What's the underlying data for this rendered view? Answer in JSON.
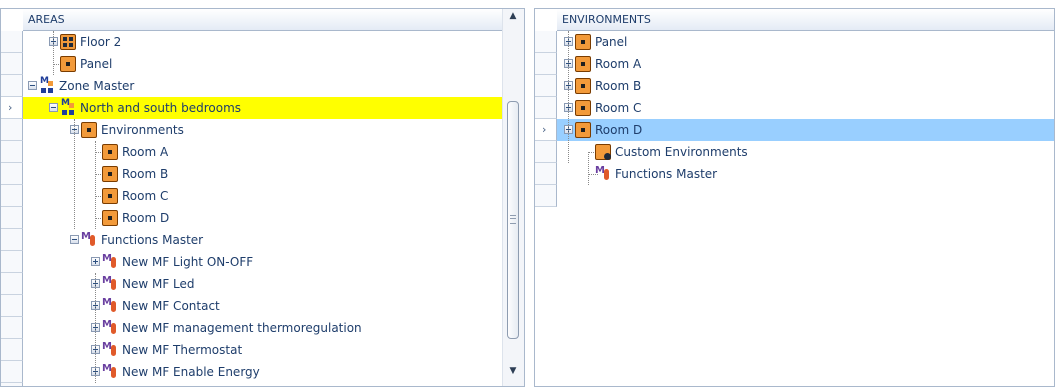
{
  "areas": {
    "header": "AREAS",
    "rows": [
      {
        "label": "Floor 2",
        "icon": "floor-icon",
        "expand": "plus"
      },
      {
        "label": "Panel",
        "icon": "environment-icon"
      },
      {
        "label": "Zone Master",
        "icon": "zone-master-icon",
        "expand": "minus"
      },
      {
        "label": "North and south bedrooms",
        "icon": "zone-master-icon",
        "expand": "minus",
        "highlighted": true
      },
      {
        "label": "Environments",
        "icon": "environment-icon",
        "expand": "minus"
      },
      {
        "label": "Room A",
        "icon": "environment-icon"
      },
      {
        "label": "Room B",
        "icon": "environment-icon"
      },
      {
        "label": "Room C",
        "icon": "environment-icon"
      },
      {
        "label": "Room D",
        "icon": "environment-icon"
      },
      {
        "label": "Functions Master",
        "icon": "functions-master-icon",
        "expand": "minus"
      },
      {
        "label": "New MF Light ON-OFF",
        "icon": "functions-master-icon",
        "expand": "plus"
      },
      {
        "label": "New MF Led",
        "icon": "functions-master-icon",
        "expand": "plus"
      },
      {
        "label": "New MF Contact",
        "icon": "functions-master-icon",
        "expand": "plus"
      },
      {
        "label": "New MF management thermoregulation",
        "icon": "functions-master-icon",
        "expand": "plus"
      },
      {
        "label": "New MF Thermostat",
        "icon": "functions-master-icon",
        "expand": "plus"
      },
      {
        "label": "New MF Enable Energy",
        "icon": "functions-master-icon",
        "expand": "plus"
      }
    ]
  },
  "environments": {
    "header": "ENVIRONMENTS",
    "rows": [
      {
        "label": "Panel",
        "icon": "environment-icon",
        "expand": "plus"
      },
      {
        "label": "Room A",
        "icon": "environment-icon",
        "expand": "plus"
      },
      {
        "label": "Room B",
        "icon": "environment-icon",
        "expand": "plus"
      },
      {
        "label": "Room C",
        "icon": "environment-icon",
        "expand": "plus"
      },
      {
        "label": "Room D",
        "icon": "environment-icon",
        "expand": "plus",
        "selected": true
      },
      {
        "label": "Custom Environments",
        "icon": "custom-environments-icon"
      },
      {
        "label": "Functions Master",
        "icon": "functions-master-icon"
      }
    ]
  },
  "glyphs": {
    "row_indicator": "›",
    "scroll_up": "▲",
    "scroll_down": "▼",
    "zone_letter": "M",
    "functions_letters": "M"
  },
  "colors": {
    "highlight": "#ffff00",
    "selection": "#99cfff",
    "environment_orange": "#f29a3a"
  }
}
